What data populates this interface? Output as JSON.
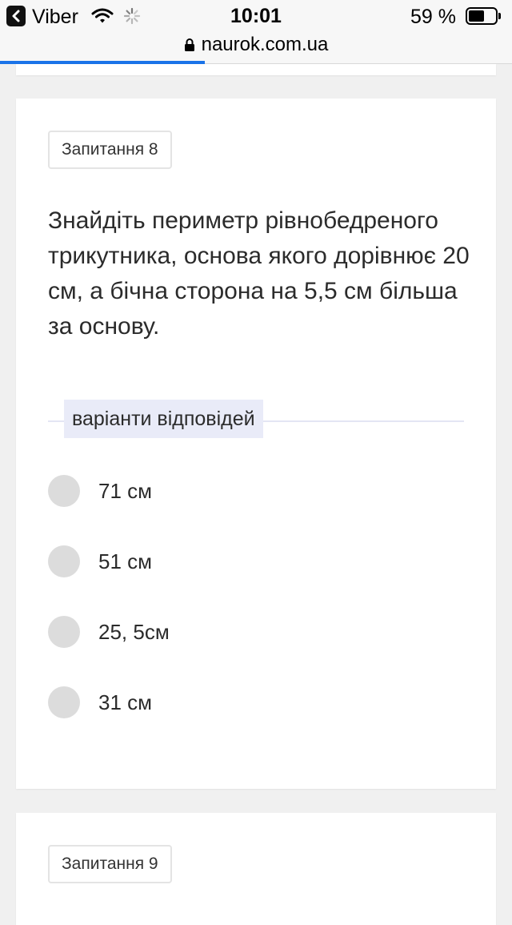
{
  "status_bar": {
    "back_app": "Viber",
    "time": "10:01",
    "battery_percent_text": "59 %",
    "battery_level": 0.59
  },
  "browser": {
    "url": "naurok.com.ua",
    "load_progress": 0.4
  },
  "question": {
    "badge": "Запитання 8",
    "text": "Знайдіть периметр рівнобедреного трикутника, основа якого дорівнює 20 см, а бічна сторона на 5,5 см більша за основу.",
    "answers_label": "варіанти відповідей",
    "options": [
      "71 см",
      "51 см",
      "25, 5см",
      "31 см"
    ]
  },
  "next_question": {
    "badge": "Запитання 9"
  },
  "colors": {
    "accent": "#1a73e8",
    "radio": "#dcdcdc",
    "label_bg": "#e9ebf8"
  }
}
